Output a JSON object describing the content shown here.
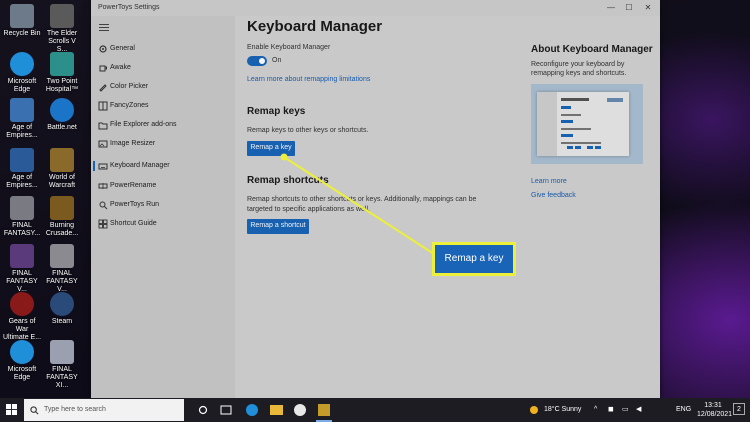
{
  "desktop_icons": [
    {
      "label": "Recycle Bin",
      "color": "#6c7a8a"
    },
    {
      "label": "The Elder Scrolls V S...",
      "color": "#5a5a5a"
    },
    {
      "label": "Microsoft Edge",
      "color": "#1e8fd8"
    },
    {
      "label": "Two Point Hospital™",
      "color": "#2c8f8a"
    },
    {
      "label": "Age of Empires...",
      "color": "#3a6fb0"
    },
    {
      "label": "Battle.net",
      "color": "#1a74c8"
    },
    {
      "label": "Age of Empires...",
      "color": "#2a5a98"
    },
    {
      "label": "World of Warcraft",
      "color": "#8a6a2a"
    },
    {
      "label": "FINAL FANTASY...",
      "color": "#7a7a82"
    },
    {
      "label": "Burning Crusade...",
      "color": "#7a5a1e"
    },
    {
      "label": "FINAL FANTASY V...",
      "color": "#5a3a7a"
    },
    {
      "label": "FINAL FANTASY V...",
      "color": "#8a8a90"
    },
    {
      "label": "Gears of War Ultimate E...",
      "color": "#8a1a1a"
    },
    {
      "label": "Steam",
      "color": "#2a4a7a"
    },
    {
      "label": "Microsoft Edge",
      "color": "#1e8fd8"
    },
    {
      "label": "FINAL FANTASY XI...",
      "color": "#9aa0b0"
    }
  ],
  "window": {
    "title": "PowerToys Settings",
    "minimize": "—",
    "maximize": "☐",
    "close": "✕"
  },
  "nav": {
    "items": [
      {
        "label": "General",
        "icon": "gear-icon"
      },
      {
        "label": "Awake",
        "icon": "coffee-icon"
      },
      {
        "label": "Color Picker",
        "icon": "eyedropper-icon"
      },
      {
        "label": "FancyZones",
        "icon": "grid-icon"
      },
      {
        "label": "File Explorer add-ons",
        "icon": "folder-icon"
      },
      {
        "label": "Image Resizer",
        "icon": "image-icon"
      },
      {
        "label": "Keyboard Manager",
        "icon": "keyboard-icon"
      },
      {
        "label": "PowerRename",
        "icon": "rename-icon"
      },
      {
        "label": "PowerToys Run",
        "icon": "search-icon"
      },
      {
        "label": "Shortcut Guide",
        "icon": "shortcut-icon"
      }
    ],
    "active_index": 6
  },
  "main": {
    "title": "Keyboard Manager",
    "enable_label": "Enable Keyboard Manager",
    "toggle_state": "On",
    "learn_more_remap_link": "Learn more about remapping limitations",
    "remap_keys_heading": "Remap keys",
    "remap_keys_desc": "Remap keys to other keys or shortcuts.",
    "remap_key_button": "Remap a key",
    "remap_shortcuts_heading": "Remap shortcuts",
    "remap_shortcuts_desc_line1": "Remap shortcuts to other shortcuts or keys. Additionally, mappings can be",
    "remap_shortcuts_desc_line2": "targeted to specific applications as well.",
    "remap_shortcut_button": "Remap a shortcut"
  },
  "about": {
    "heading": "About Keyboard Manager",
    "desc_line1": "Reconfigure your keyboard by",
    "desc_line2": "remapping keys and shortcuts.",
    "learn_more": "Learn more",
    "give_feedback": "Give feedback"
  },
  "callout": {
    "label": "Remap a key",
    "border_color": "#ecf03a"
  },
  "taskbar": {
    "search_placeholder": "Type here to search",
    "weather": "18°C  Sunny",
    "language": "ENG",
    "time": "13:31",
    "date": "12/08/2021",
    "notification_count": "2"
  }
}
